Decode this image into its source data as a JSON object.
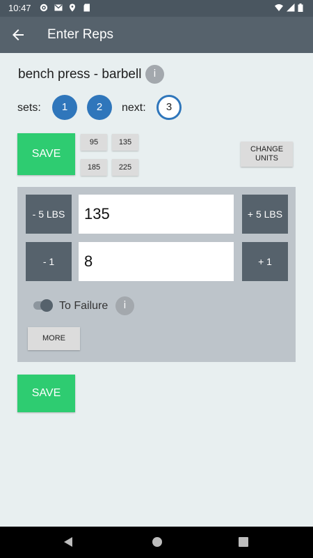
{
  "status_bar": {
    "time": "10:47"
  },
  "app_bar": {
    "title": "Enter Reps"
  },
  "exercise": {
    "name": "bench press - barbell",
    "info_glyph": "i"
  },
  "sets": {
    "label": "sets:",
    "done": [
      "1",
      "2"
    ],
    "next_label": "next:",
    "next": "3"
  },
  "actions": {
    "save_label": "SAVE",
    "change_units_label": "CHANGE\nUNITS"
  },
  "quick_weights": [
    "95",
    "135",
    "185",
    "225"
  ],
  "weight": {
    "minus_label": "- 5 LBS",
    "plus_label": "+ 5 LBS",
    "value": "135"
  },
  "reps": {
    "minus_label": "- 1",
    "plus_label": "+ 1",
    "value": "8"
  },
  "failure": {
    "label": "To Failure",
    "info_glyph": "i"
  },
  "more_label": "MORE",
  "colors": {
    "accent": "#2f76bb",
    "save": "#2ecc71",
    "appbar": "#56626c",
    "panel": "#bdc4ca"
  }
}
